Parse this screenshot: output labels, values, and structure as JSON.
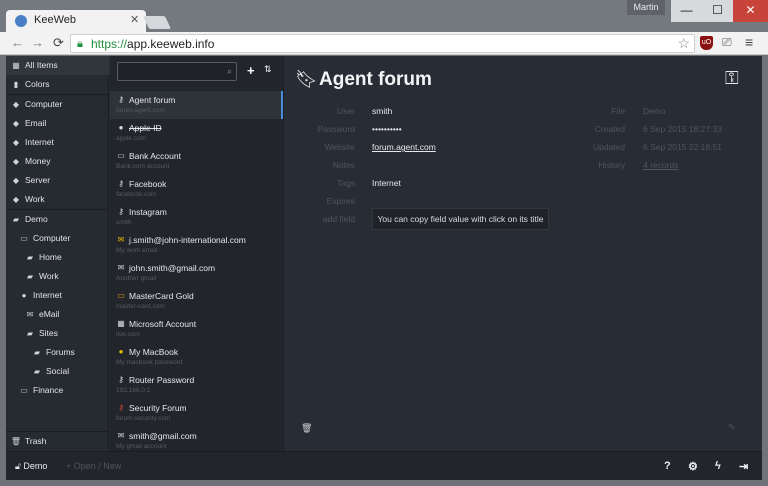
{
  "browser": {
    "tab_title": "KeeWeb",
    "tab_close": "✕",
    "user_name": "Martin",
    "window_controls": {
      "minimize": "—",
      "maximize": "☐",
      "close": "✕"
    },
    "url_scheme": "https://",
    "url_host": "app.keeweb.info",
    "nav": {
      "back": "←",
      "forward": "→",
      "reload": "⟳"
    },
    "ext_ublock": "uO",
    "menu_glyph": "≡"
  },
  "menu": {
    "all_items": "All Items",
    "colors": "Colors",
    "tags": [
      "Computer",
      "Email",
      "Internet",
      "Money",
      "Server",
      "Work"
    ],
    "groups": {
      "demo": "Demo",
      "computer": "Computer",
      "home": "Home",
      "work": "Work",
      "internet": "Internet",
      "email": "eMail",
      "sites": "Sites",
      "forums": "Forums",
      "social": "Social",
      "finance": "Finance"
    },
    "trash": "Trash"
  },
  "list": {
    "search_placeholder": "",
    "add_glyph": "+",
    "sort_glyph": "⇅",
    "items": [
      {
        "icon": "key-icon",
        "glyph": "⚷",
        "title": "Agent forum",
        "sub": "forum.agent.com"
      },
      {
        "icon": "globe-icon",
        "glyph": "●",
        "title": "Apple ID",
        "sub": "apple.com"
      },
      {
        "icon": "card-icon",
        "glyph": "▭",
        "title": "Bank Account",
        "sub": "Bank.com account"
      },
      {
        "icon": "key-icon",
        "glyph": "⚷",
        "title": "Facebook",
        "sub": "facebook.com"
      },
      {
        "icon": "key-icon",
        "glyph": "⚷",
        "title": "Instagram",
        "sub": "smith"
      },
      {
        "icon": "mail-icon",
        "glyph": "✉",
        "title": "j.smith@john-international.com",
        "sub": "My work email"
      },
      {
        "icon": "mail-icon",
        "glyph": "✉",
        "title": "john.smith@gmail.com",
        "sub": "Another gmail"
      },
      {
        "icon": "card-icon",
        "glyph": "▭",
        "title": "MasterCard Gold",
        "sub": "master-card.com"
      },
      {
        "icon": "windows-icon",
        "glyph": "▦",
        "title": "Microsoft Account",
        "sub": "live.com"
      },
      {
        "icon": "apple-icon",
        "glyph": "●",
        "title": "My MacBook",
        "sub": "My macbook password"
      },
      {
        "icon": "key-icon",
        "glyph": "⚷",
        "title": "Router Password",
        "sub": "192.168.0.1"
      },
      {
        "icon": "key-icon",
        "glyph": "⚷",
        "title": "Security Forum",
        "sub": "forum.security.com"
      },
      {
        "icon": "mail-icon",
        "glyph": "✉",
        "title": "smith@gmail.com",
        "sub": "My gmail account"
      }
    ]
  },
  "detail": {
    "title": "Agent forum",
    "fields": {
      "user_label": "User",
      "user_value": "smith",
      "password_label": "Password",
      "password_value": "••••••••••",
      "website_label": "Website",
      "website_value": "forum.agent.com",
      "notes_label": "Notes",
      "tags_label": "Tags",
      "tags_value": "Internet",
      "expires_label": "Expires",
      "add_field_label": "add field",
      "file_label": "File",
      "file_value": "Demo",
      "created_label": "Created",
      "created_value": "6 Sep 2015 18:27:33",
      "updated_label": "Updated",
      "updated_value": "6 Sep 2015 22:18:51",
      "history_label": "History",
      "history_value": "4 records"
    },
    "tip": "You can copy field value with click on its title"
  },
  "footer": {
    "db_name": "Demo",
    "open_new": "+ Open / New",
    "help": "?",
    "settings": "⚙",
    "generate": "ϟ",
    "lock": "⇥"
  },
  "colors": {
    "app_bg": "#282c34",
    "sidebar_bg": "#262b31",
    "accent": "#4a8ad8",
    "yellow_icon": "#e6b800",
    "red_icon": "#d0452c",
    "chrome_close": "#c8433a"
  }
}
